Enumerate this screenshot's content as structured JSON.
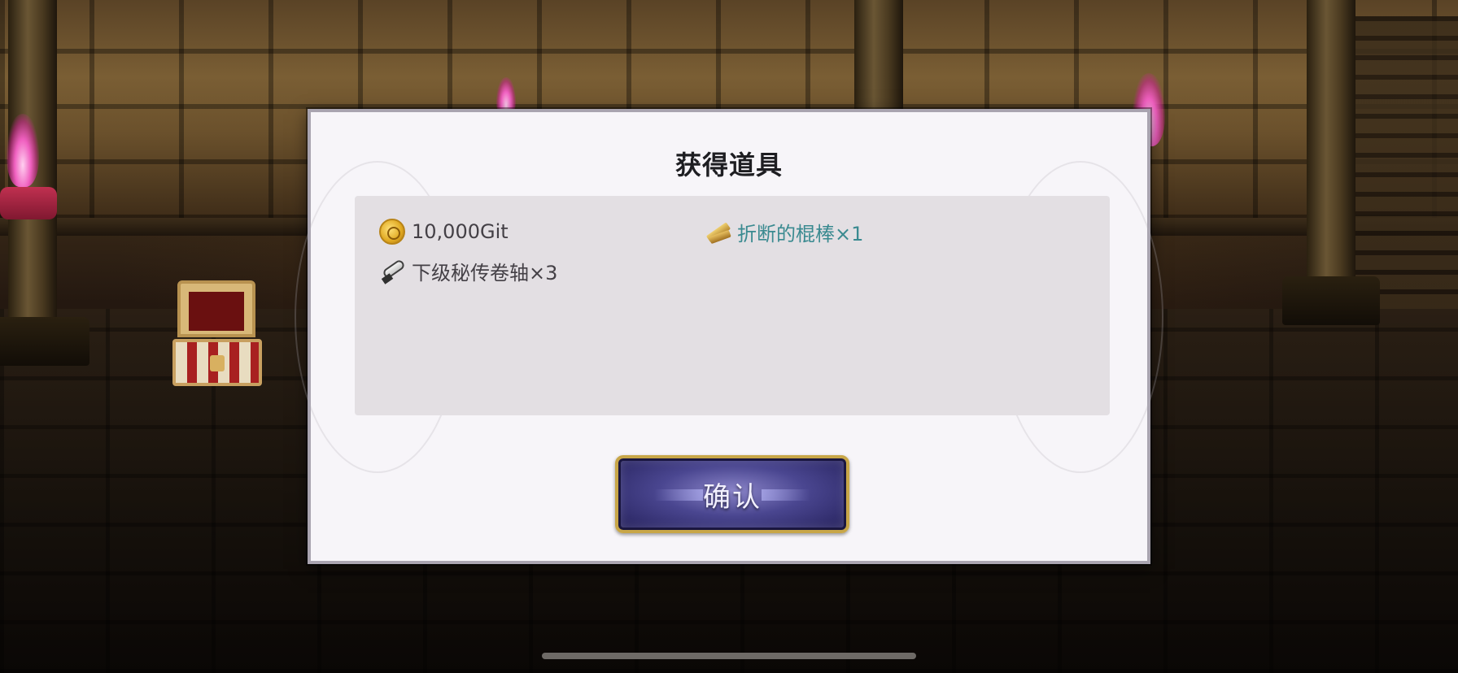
{
  "dialog": {
    "title": "获得道具",
    "items": [
      {
        "icon": "coin-icon",
        "label": "10,000Git",
        "rarity": "normal"
      },
      {
        "icon": "broken-stick-icon",
        "label": "折断的棍棒×1",
        "rarity": "rare"
      },
      {
        "icon": "scroll-icon",
        "label": "下级秘传卷轴×3",
        "rarity": "normal"
      }
    ],
    "confirm_label": "确认"
  },
  "colors": {
    "rare_text": "#3a8a90",
    "normal_text": "#444046",
    "button_border": "#c8a648"
  }
}
